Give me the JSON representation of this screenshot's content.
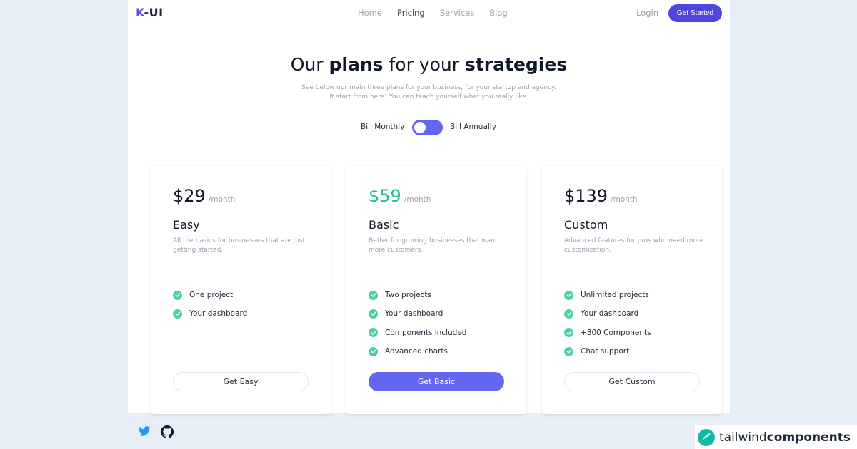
{
  "nav": {
    "logo_prefix": "K",
    "logo_suffix": "-UI",
    "links": [
      {
        "label": "Home"
      },
      {
        "label": "Pricing"
      },
      {
        "label": "Services"
      },
      {
        "label": "Blog"
      }
    ],
    "login": "Login",
    "cta": "Get Started"
  },
  "hero": {
    "title_1": "Our ",
    "title_2": "plans",
    "title_3": " for your ",
    "title_4": "strategies",
    "subtitle_line1": "See below our main three plans for your business, for your startup and agency.",
    "subtitle_line2": "It start from here! You can teach yourself what you really like."
  },
  "billing": {
    "monthly_label": "Bill Monthly",
    "annually_label": "Bill Annually",
    "toggle_state": "monthly"
  },
  "plans": [
    {
      "price": "$29",
      "period": "/month",
      "name": "Easy",
      "description": "All the basics for businesses that are just getting started.",
      "features": [
        "One project",
        "Your dashboard"
      ],
      "button": "Get Easy"
    },
    {
      "price": "$59",
      "period": "/month",
      "name": "Basic",
      "description": "Better for growing businesses that want more customers.",
      "features": [
        "Two projects",
        "Your dashboard",
        "Components included",
        "Advanced charts"
      ],
      "button": "Get Basic"
    },
    {
      "price": "$139",
      "period": "/month",
      "name": "Custom",
      "description": "Advanced features for pros who need more customization.",
      "features": [
        "Unlimited projects",
        "Your dashboard",
        "+300 Components",
        "Chat support"
      ],
      "button": "Get Custom"
    }
  ],
  "footer": {
    "icons": [
      "twitter-icon",
      "github-icon"
    ],
    "badge_light": "tailwind",
    "badge_bold": "components"
  },
  "colors": {
    "accent": "#5145e0",
    "toggle": "#6366f1",
    "featured_price": "#22c08a",
    "check": "#4fd1a1",
    "background": "#e8eef8"
  }
}
